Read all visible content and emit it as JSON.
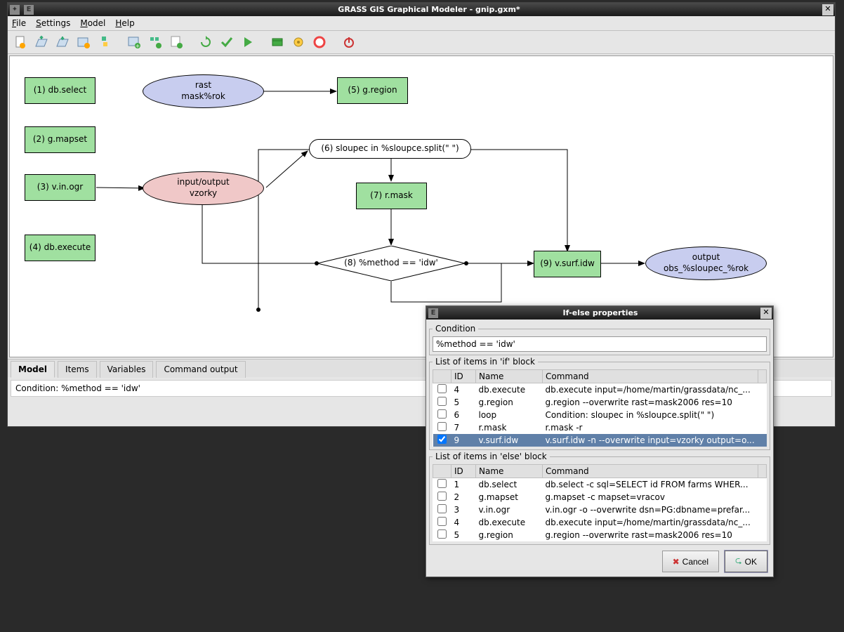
{
  "main": {
    "title": "GRASS GIS Graphical Modeler - gnip.gxm*",
    "menus": {
      "file": "File",
      "settings": "Settings",
      "model": "Model",
      "help": "Help"
    },
    "tabs": {
      "model": "Model",
      "items": "Items",
      "variables": "Variables",
      "output": "Command output"
    },
    "status": "Condition: %method == 'idw'"
  },
  "nodes": {
    "n1": "(1) db.select",
    "n2": "(2) g.mapset",
    "n3": "(3) v.in.ogr",
    "n4": "(4) db.execute",
    "n5": "(5) g.region",
    "n7": "(7) r.mask",
    "n9": "(9) v.surf.idw",
    "rast_line1": "rast",
    "rast_line2": "mask%rok",
    "io_line1": "input/output",
    "io_line2": "vzorky",
    "out_line1": "output",
    "out_line2": "obs_%sloupec_%rok",
    "loop": "(6) sloupec in %sloupce.split(\" \")",
    "cond": "(8) %method == 'idw'"
  },
  "dialog": {
    "title": "If-else properties",
    "cond_label": "Condition",
    "cond_value": "%method == 'idw'",
    "if_label": "List of items in 'if' block",
    "else_label": "List of items in 'else' block",
    "headers": {
      "id": "ID",
      "name": "Name",
      "command": "Command"
    },
    "if_rows": [
      {
        "chk": false,
        "id": "4",
        "name": "db.execute",
        "cmd": "db.execute input=/home/martin/grassdata/nc_..."
      },
      {
        "chk": false,
        "id": "5",
        "name": "g.region",
        "cmd": "g.region --overwrite rast=mask2006 res=10"
      },
      {
        "chk": false,
        "id": "6",
        "name": "loop",
        "cmd": "Condition: sloupec in %sloupce.split(\" \")"
      },
      {
        "chk": false,
        "id": "7",
        "name": "r.mask",
        "cmd": "r.mask -r"
      },
      {
        "chk": true,
        "id": "9",
        "name": "v.surf.idw",
        "cmd": "v.surf.idw -n --overwrite input=vzorky output=o...",
        "sel": true
      }
    ],
    "else_rows": [
      {
        "chk": false,
        "id": "1",
        "name": "db.select",
        "cmd": "db.select -c sql=SELECT id FROM farms WHER..."
      },
      {
        "chk": false,
        "id": "2",
        "name": "g.mapset",
        "cmd": "g.mapset -c mapset=vracov"
      },
      {
        "chk": false,
        "id": "3",
        "name": "v.in.ogr",
        "cmd": "v.in.ogr -o --overwrite dsn=PG:dbname=prefar..."
      },
      {
        "chk": false,
        "id": "4",
        "name": "db.execute",
        "cmd": "db.execute input=/home/martin/grassdata/nc_..."
      },
      {
        "chk": false,
        "id": "5",
        "name": "g.region",
        "cmd": "g.region --overwrite rast=mask2006 res=10"
      }
    ],
    "cancel": "Cancel",
    "ok": "OK"
  }
}
